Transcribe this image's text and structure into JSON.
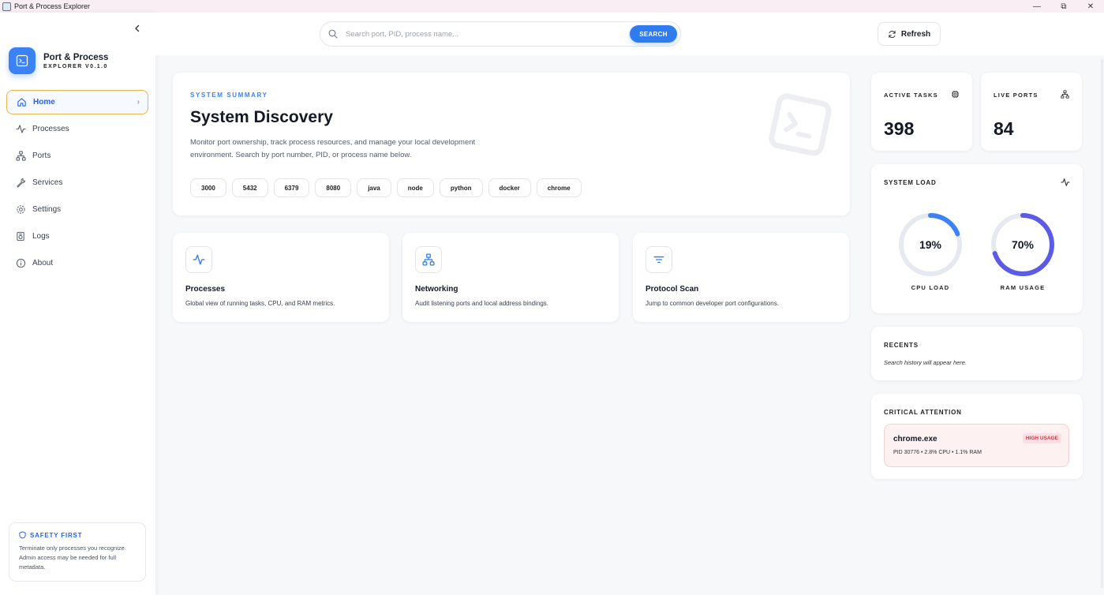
{
  "window": {
    "title": "Port & Process Explorer",
    "minimize": "—",
    "restore": "⧉",
    "close": "✕"
  },
  "sidebar": {
    "brand_title": "Port & Process",
    "brand_subtitle": "EXPLORER V0.1.0",
    "items": [
      {
        "label": "Home",
        "icon": "home-icon",
        "active": true
      },
      {
        "label": "Processes",
        "icon": "activity-icon"
      },
      {
        "label": "Ports",
        "icon": "network-icon"
      },
      {
        "label": "Services",
        "icon": "wrench-icon"
      },
      {
        "label": "Settings",
        "icon": "gear-icon"
      },
      {
        "label": "Logs",
        "icon": "logs-icon"
      },
      {
        "label": "About",
        "icon": "info-icon"
      }
    ],
    "safety": {
      "title": "SAFETY FIRST",
      "text": "Terminate only processes you recognize. Admin access may be needed for full metadata."
    }
  },
  "header": {
    "search_placeholder": "Search port, PID, process name...",
    "search_button": "SEARCH",
    "refresh_label": "Refresh"
  },
  "summary": {
    "eyebrow": "SYSTEM SUMMARY",
    "title": "System Discovery",
    "description": "Monitor port ownership, track process resources, and manage your local development environment. Search by port number, PID, or process name below.",
    "chips": [
      "3000",
      "5432",
      "6379",
      "8080",
      "java",
      "node",
      "python",
      "docker",
      "chrome"
    ]
  },
  "features": [
    {
      "title": "Processes",
      "desc": "Global view of running tasks, CPU, and RAM metrics.",
      "icon": "activity-icon"
    },
    {
      "title": "Networking",
      "desc": "Audit listening ports and local address bindings.",
      "icon": "network-icon"
    },
    {
      "title": "Protocol Scan",
      "desc": "Jump to common developer port configurations.",
      "icon": "filter-icon"
    }
  ],
  "stats": {
    "active_tasks_label": "ACTIVE TASKS",
    "active_tasks_value": "398",
    "live_ports_label": "LIVE PORTS",
    "live_ports_value": "84"
  },
  "system_load": {
    "title": "SYSTEM LOAD",
    "cpu_label": "CPU LOAD",
    "cpu_text": "19%",
    "cpu_value": 19,
    "ram_label": "RAM USAGE",
    "ram_text": "70%",
    "ram_value": 70,
    "cpu_color": "#3b82f6",
    "ram_color": "#5b5be8",
    "track_color": "#e6e9f0"
  },
  "recents": {
    "title": "RECENTS",
    "empty_text": "Search history will appear here."
  },
  "critical": {
    "title": "CRITICAL ATTENTION",
    "process_name": "chrome.exe",
    "badge": "HIGH USAGE",
    "meta": "PID 30776 • 2.8% CPU • 1.1% RAM"
  }
}
